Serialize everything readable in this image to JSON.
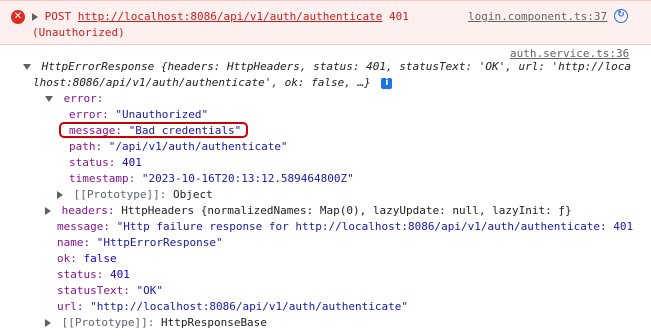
{
  "error_message": {
    "icon": "error-circle-icon",
    "method": "POST",
    "url": "http://localhost:8086/api/v1/auth/authenticate",
    "status_code": "401",
    "status_text": "(Unauthorized)",
    "source_link": "login.component.ts:37",
    "source_icon": "open-in-source-icon"
  },
  "log": {
    "source_link": "auth.service.ts:36",
    "summary_line1_prefix": "HttpErrorResponse {headers: HttpHeaders, status: 401, statusText: 'OK', url: 'http://loca",
    "summary_line2": "lhost:8086/api/v1/auth/authenticate', ok: false, …}",
    "info_badge": "i",
    "error_key": "error:",
    "error_fields": [
      {
        "key": "error:",
        "value": "\"Unauthorized\"",
        "type": "string"
      },
      {
        "key": "message:",
        "value": "\"Bad credentials\"",
        "type": "string"
      },
      {
        "key": "path:",
        "value": "\"/api/v1/auth/authenticate\"",
        "type": "string"
      },
      {
        "key": "status:",
        "value": "401",
        "type": "number"
      },
      {
        "key": "timestamp:",
        "value": "\"2023-10-16T20:13:12.589464800Z\"",
        "type": "string"
      }
    ],
    "error_prototype": {
      "key": "[[Prototype]]:",
      "value": "Object"
    },
    "headers": {
      "key": "headers:",
      "value": "HttpHeaders {normalizedNames: Map(0), lazyUpdate: null, lazyInit: ƒ}"
    },
    "top_fields": [
      {
        "key": "message:",
        "value": "\"Http failure response for http://localhost:8086/api/v1/auth/authenticate: 401"
      },
      {
        "key": "name:",
        "value": "\"HttpErrorResponse\""
      },
      {
        "key": "ok:",
        "value": "false"
      },
      {
        "key": "status:",
        "value": "401"
      },
      {
        "key": "statusText:",
        "value": "\"OK\""
      },
      {
        "key": "url:",
        "value": "\"http://localhost:8086/api/v1/auth/authenticate\""
      }
    ],
    "root_prototype": {
      "key": "[[Prototype]]:",
      "value": "HttpResponseBase"
    }
  },
  "colors": {
    "error_background": "#fff0f0",
    "error_text": "#c5221f",
    "property_key": "#881391",
    "string_value": "#c80000",
    "number_value": "#1c00cf",
    "highlight_border": "#d00000"
  }
}
